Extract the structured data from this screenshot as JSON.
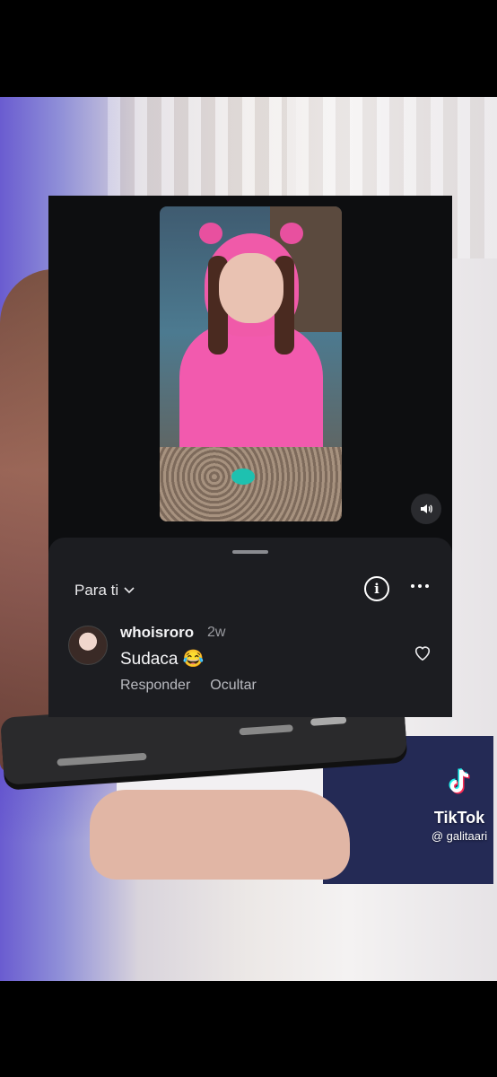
{
  "sheet": {
    "feed_selector": "Para ti",
    "comment": {
      "username": "whoisroro",
      "time": "2w",
      "text": "Sudaca 😂",
      "reply_label": "Responder",
      "hide_label": "Ocultar"
    }
  },
  "watermark": {
    "brand": "TikTok",
    "handle": "@ galitaari"
  },
  "icons": {
    "mute": "speaker-icon",
    "info": "info-icon",
    "more": "more-icon",
    "like": "heart-icon",
    "dropdown": "chevron-down-icon"
  }
}
